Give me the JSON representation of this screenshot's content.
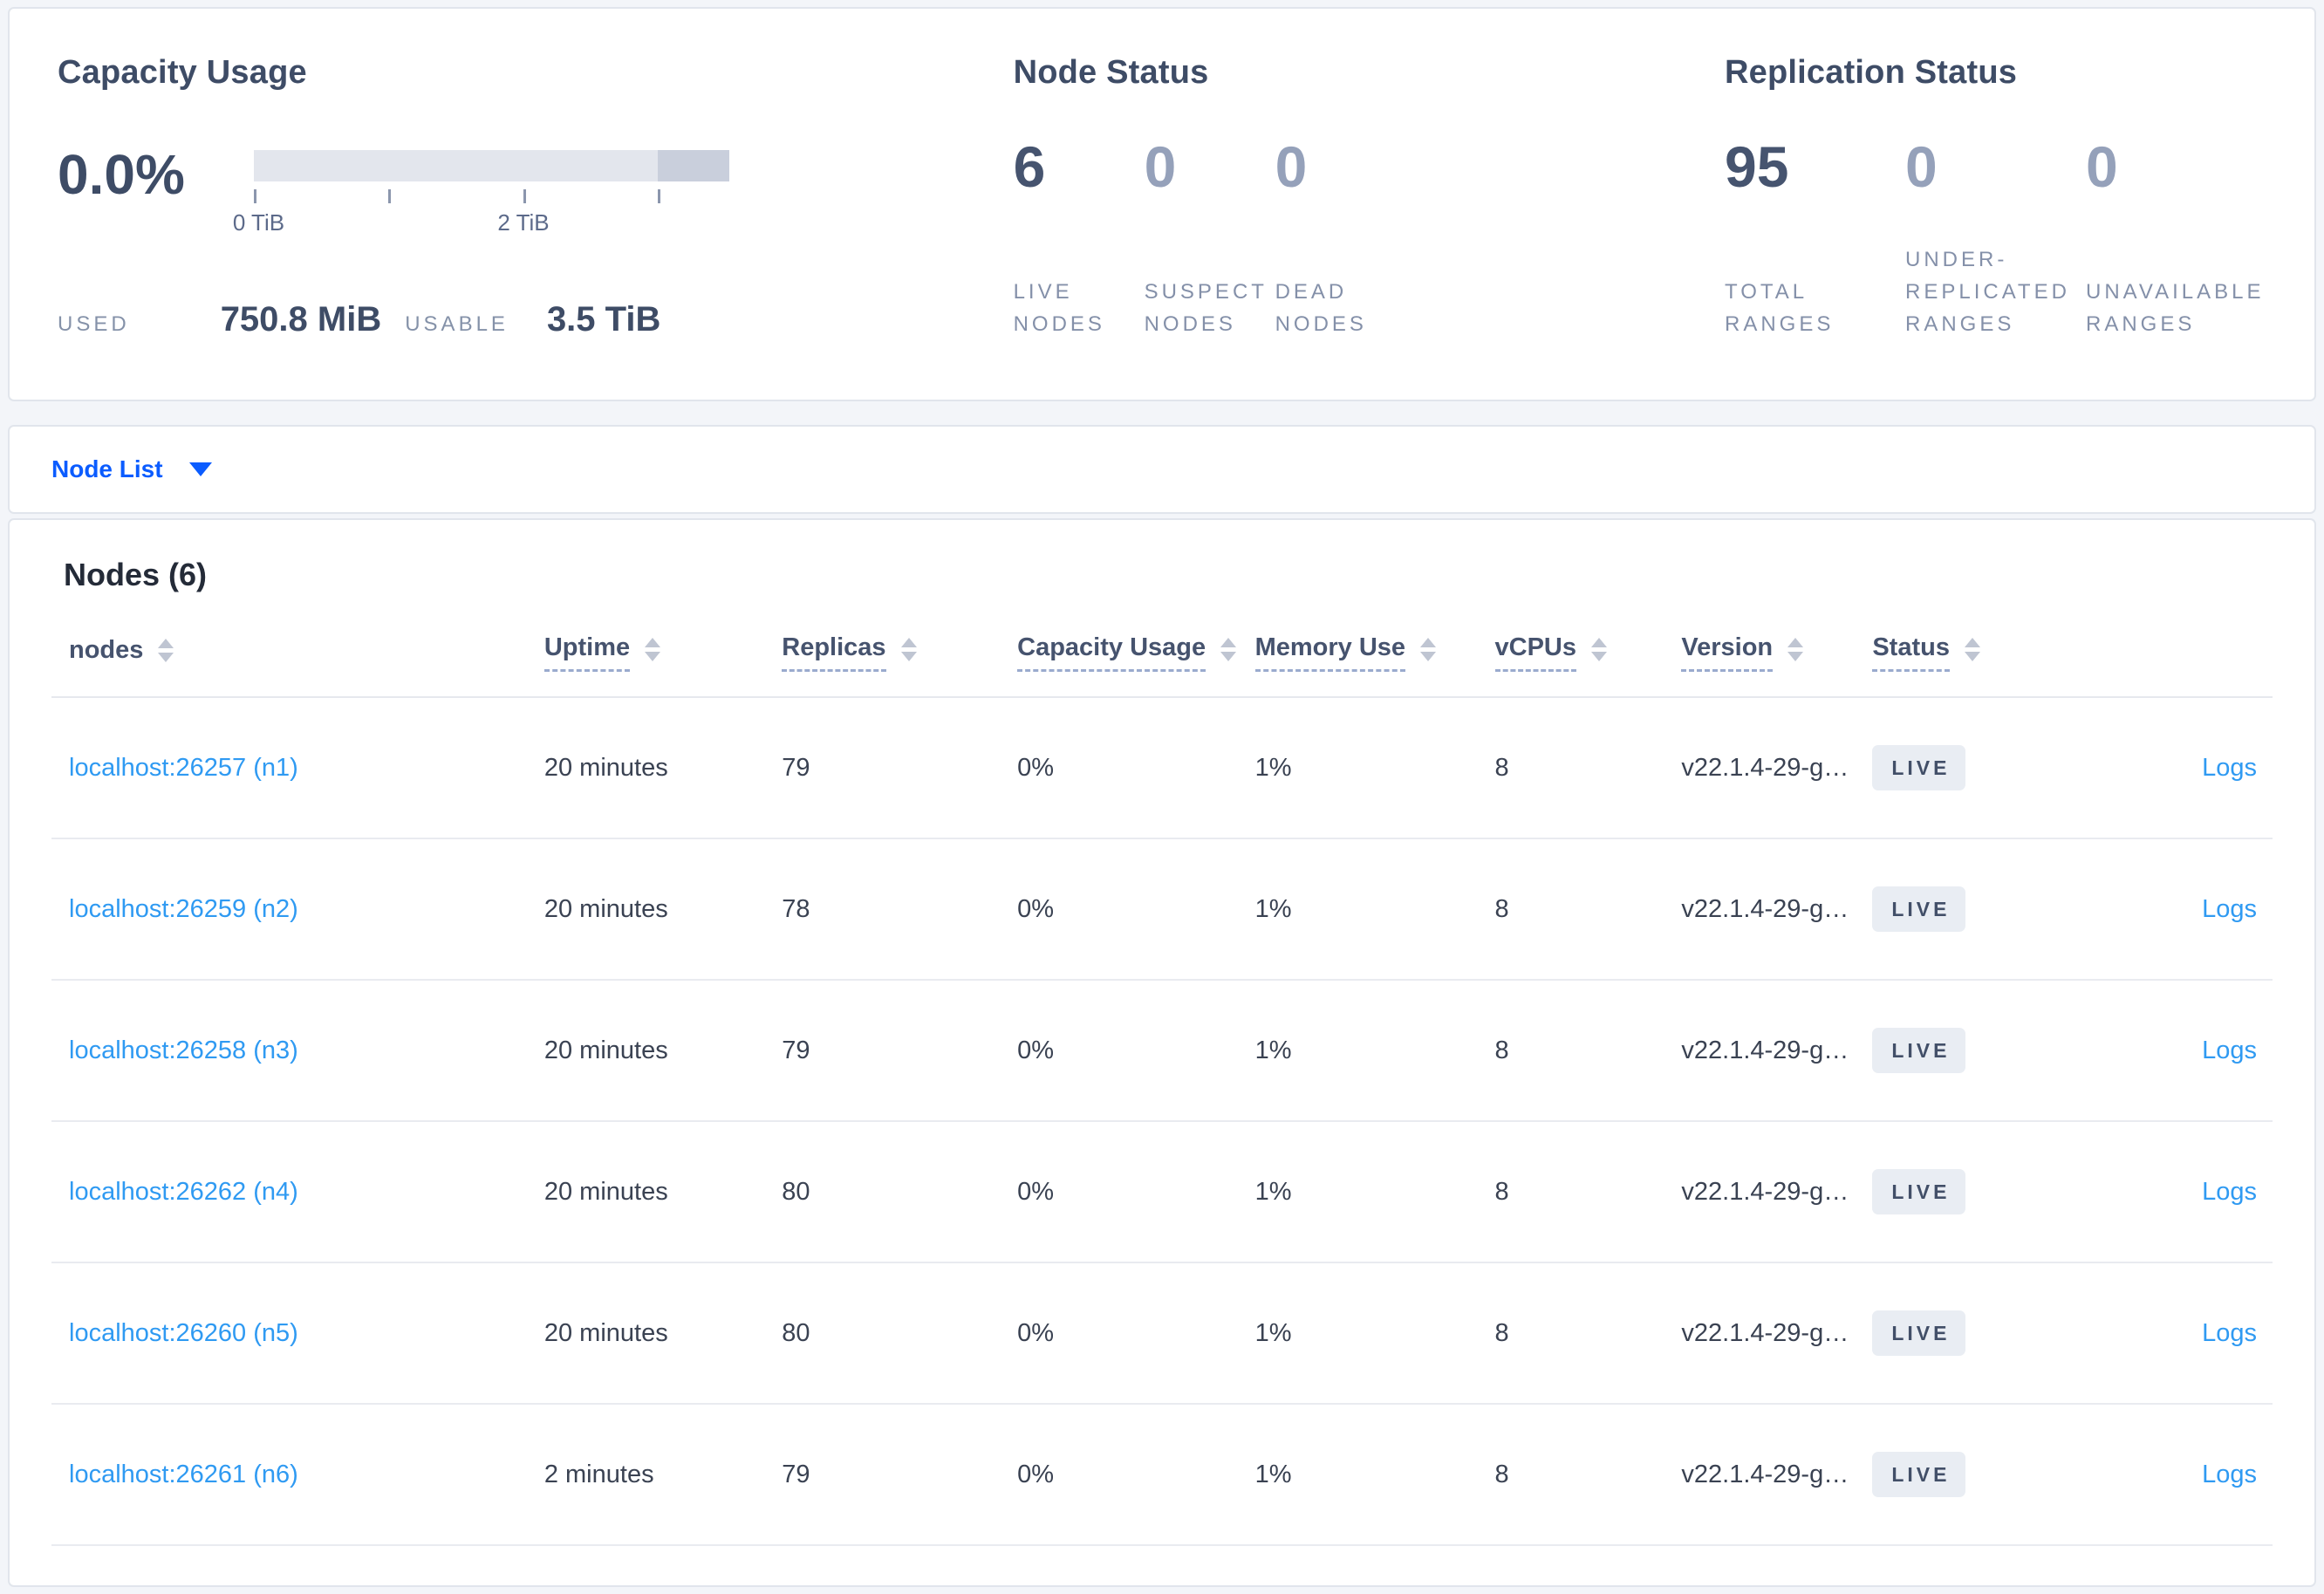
{
  "summary": {
    "capacity": {
      "title": "Capacity Usage",
      "percent": "0.0%",
      "tick_labels": [
        "0 TiB",
        "2 TiB"
      ],
      "used_label": "USED",
      "used_value": "750.8 MiB",
      "usable_label": "USABLE",
      "usable_value": "3.5 TiB"
    },
    "node_status": {
      "title": "Node Status",
      "stats": [
        {
          "value": "6",
          "label": "LIVE NODES",
          "muted": false
        },
        {
          "value": "0",
          "label": "SUSPECT NODES",
          "muted": true
        },
        {
          "value": "0",
          "label": "DEAD NODES",
          "muted": true
        }
      ]
    },
    "replication": {
      "title": "Replication Status",
      "stats": [
        {
          "value": "95",
          "label": "TOTAL RANGES",
          "muted": false
        },
        {
          "value": "0",
          "label": "UNDER-REPLICATED RANGES",
          "muted": true
        },
        {
          "value": "0",
          "label": "UNAVAILABLE RANGES",
          "muted": true
        }
      ]
    }
  },
  "node_list": {
    "label": "Node List"
  },
  "nodes_table": {
    "title": "Nodes (6)",
    "columns": [
      {
        "label": "nodes",
        "sortable_underline": false
      },
      {
        "label": "Uptime",
        "sortable_underline": true
      },
      {
        "label": "Replicas",
        "sortable_underline": true
      },
      {
        "label": "Capacity Usage",
        "sortable_underline": true
      },
      {
        "label": "Memory Use",
        "sortable_underline": true
      },
      {
        "label": "vCPUs",
        "sortable_underline": true
      },
      {
        "label": "Version",
        "sortable_underline": true
      },
      {
        "label": "Status",
        "sortable_underline": true
      }
    ],
    "logs_label": "Logs",
    "rows": [
      {
        "address": "localhost:26257 (n1)",
        "uptime": "20 minutes",
        "replicas": "79",
        "capacity": "0%",
        "memory": "1%",
        "vcpus": "8",
        "version": "v22.1.4-29-g…",
        "status": "LIVE"
      },
      {
        "address": "localhost:26259 (n2)",
        "uptime": "20 minutes",
        "replicas": "78",
        "capacity": "0%",
        "memory": "1%",
        "vcpus": "8",
        "version": "v22.1.4-29-g…",
        "status": "LIVE"
      },
      {
        "address": "localhost:26258 (n3)",
        "uptime": "20 minutes",
        "replicas": "79",
        "capacity": "0%",
        "memory": "1%",
        "vcpus": "8",
        "version": "v22.1.4-29-g…",
        "status": "LIVE"
      },
      {
        "address": "localhost:26262 (n4)",
        "uptime": "20 minutes",
        "replicas": "80",
        "capacity": "0%",
        "memory": "1%",
        "vcpus": "8",
        "version": "v22.1.4-29-g…",
        "status": "LIVE"
      },
      {
        "address": "localhost:26260 (n5)",
        "uptime": "20 minutes",
        "replicas": "80",
        "capacity": "0%",
        "memory": "1%",
        "vcpus": "8",
        "version": "v22.1.4-29-g…",
        "status": "LIVE"
      },
      {
        "address": "localhost:26261 (n6)",
        "uptime": "2 minutes",
        "replicas": "79",
        "capacity": "0%",
        "memory": "1%",
        "vcpus": "8",
        "version": "v22.1.4-29-g…",
        "status": "LIVE"
      }
    ]
  },
  "colors": {
    "page_background": "#f3f5f9",
    "card_border": "#e1e5ec",
    "heading_text": "#3e4c66",
    "muted_stat": "#95a1ba",
    "label_gray": "#8490a9",
    "accent_blue": "#0b5cff",
    "link_blue": "#2f9af2",
    "badge_background": "#e9edf3",
    "capacity_bar_light": "#e3e6ed",
    "capacity_bar_dark": "#c9cfdc"
  }
}
